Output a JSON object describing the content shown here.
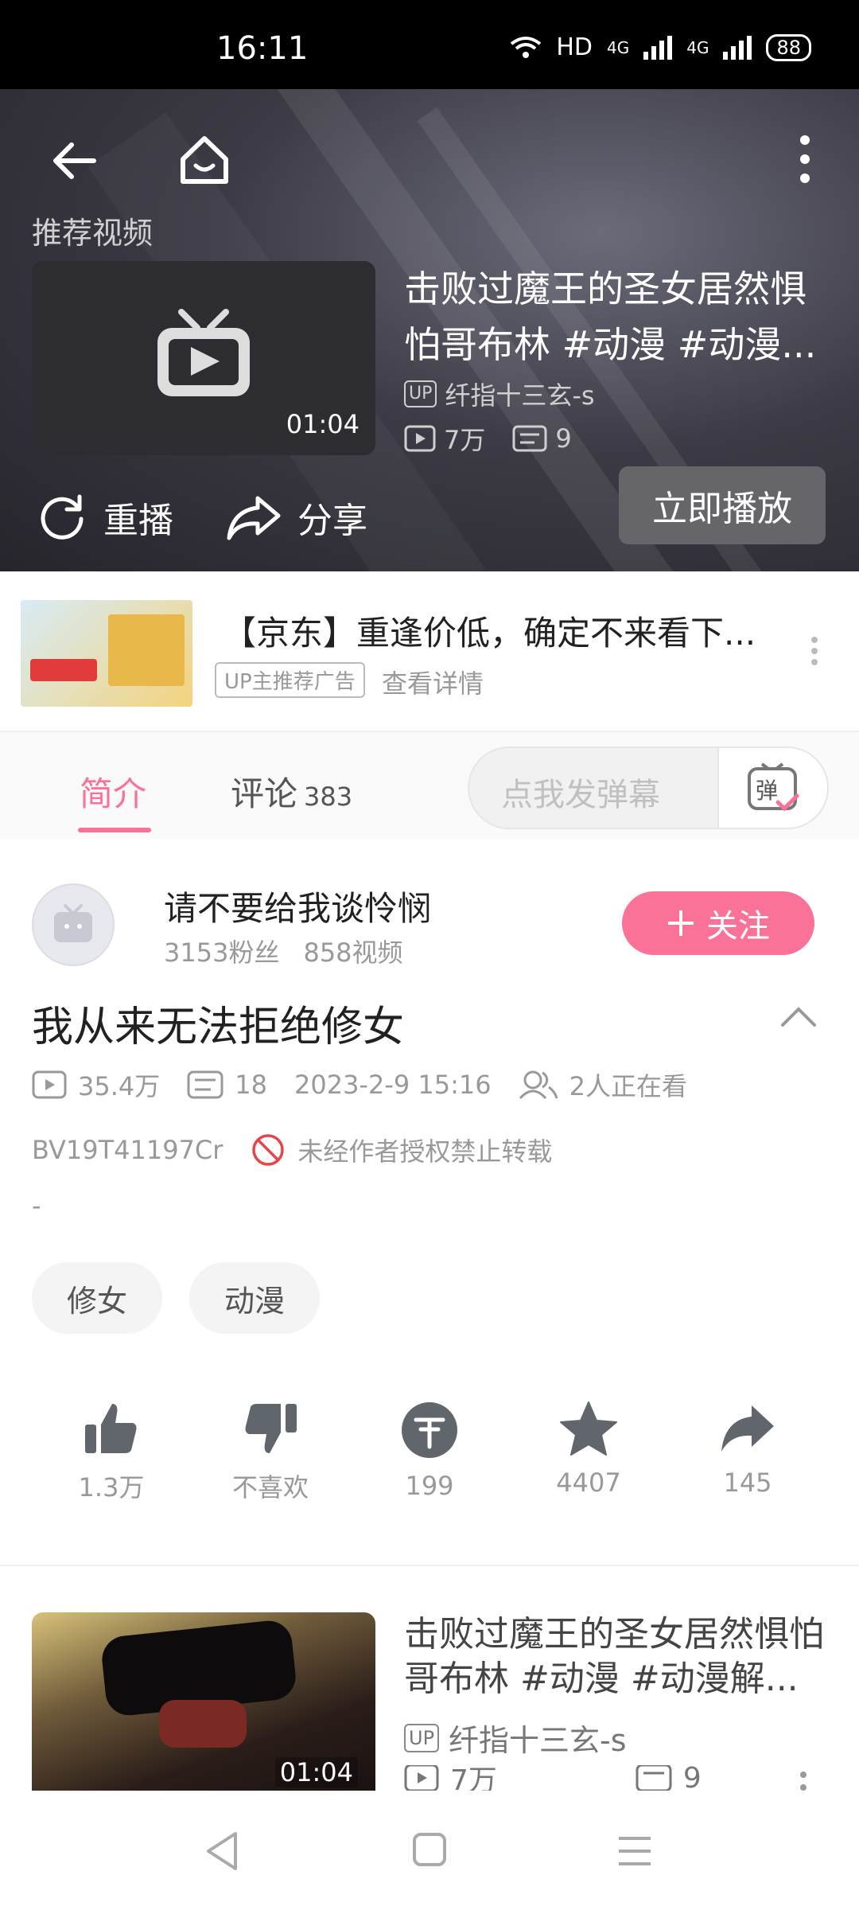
{
  "status_bar": {
    "time": "16:11",
    "network": "HD",
    "signal1": "4G",
    "signal2": "4G",
    "battery": "88"
  },
  "player": {
    "section_label": "推荐视频",
    "recommended": {
      "title": "击败过魔王的圣女居然惧怕哥布林 #动漫 #动漫...",
      "duration": "01:04",
      "uploader_badge": "UP",
      "uploader": "纤指十三玄-s",
      "views": "7万",
      "danmaku": "9"
    },
    "play_now_label": "立即播放",
    "replay_label": "重播",
    "share_label": "分享"
  },
  "ad": {
    "title": "【京东】重逢价低，确定不来看下...",
    "badge": "UP主推荐广告",
    "link": "查看详情"
  },
  "tabs": {
    "intro": "简介",
    "comments": "评论",
    "comments_count": "383",
    "danmaku_placeholder": "点我发弹幕",
    "danmaku_button": "弹"
  },
  "uploader": {
    "name": "请不要给我谈怜悯",
    "fans": "3153粉丝",
    "videos": "858视频",
    "follow_label": "关注"
  },
  "video": {
    "title": "我从来无法拒绝修女",
    "views": "35.4万",
    "danmaku": "18",
    "date": "2023-2-9 15:16",
    "watching": "2人正在看",
    "bvid": "BV19T41197Cr",
    "notice": "未经作者授权禁止转载",
    "description": "-",
    "tags": [
      "修女",
      "动漫"
    ]
  },
  "actions": {
    "like": "1.3万",
    "dislike": "不喜欢",
    "coin": "199",
    "favorite": "4407",
    "share": "145"
  },
  "related": {
    "title": "击败过魔王的圣女居然惧怕哥布林 #动漫 #动漫解...",
    "duration": "01:04",
    "uploader_badge": "UP",
    "uploader": "纤指十三玄-s",
    "views": "7万",
    "danmaku": "9"
  },
  "colors": {
    "accent": "#fb7299",
    "dark_bg": "#2d2d31"
  }
}
